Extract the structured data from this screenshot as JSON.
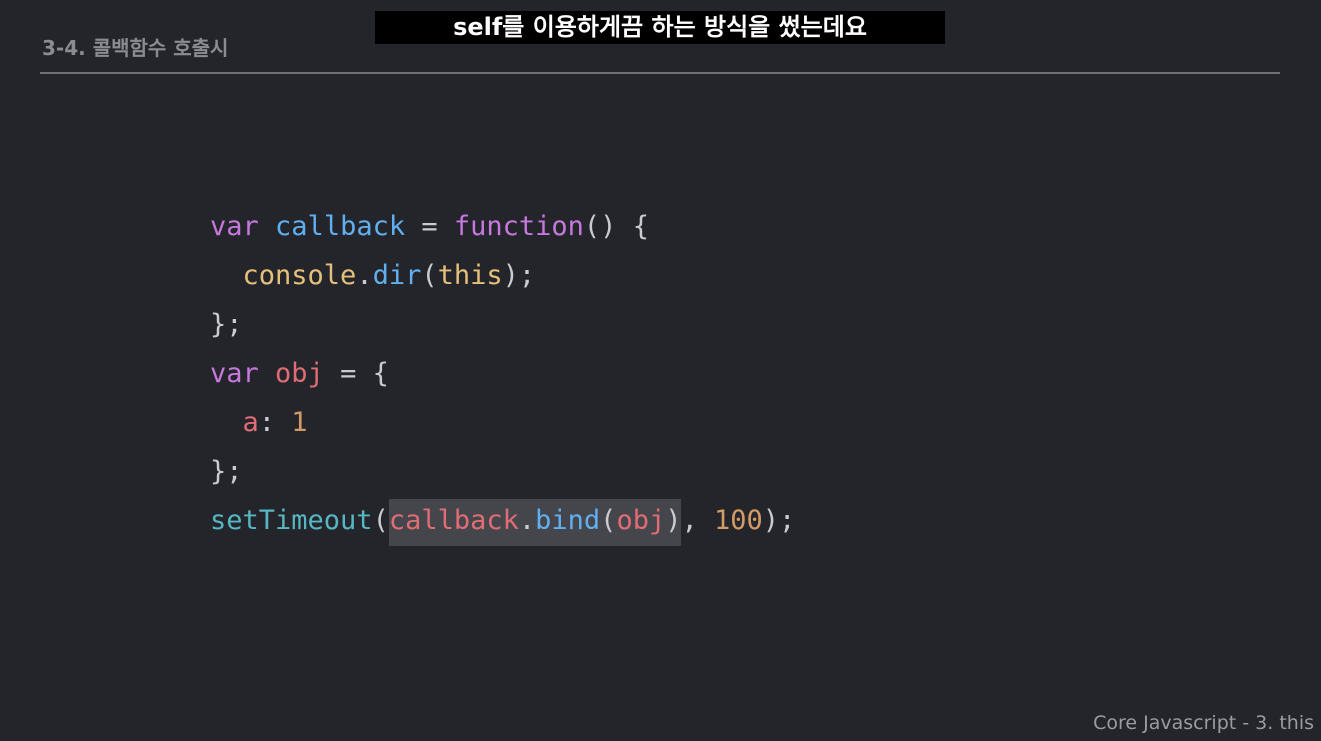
{
  "subtitle": "self를 이용하게끔 하는 방식을 썼는데요",
  "section_title": "3-4. 콜백함수 호출시",
  "footer": "Core Javascript - 3. this",
  "code": {
    "l1": {
      "kw": "var",
      "name": "callback",
      "eq": " = ",
      "fn": "function",
      "rest": "() {"
    },
    "l2": {
      "indent": "  ",
      "obj": "console",
      "dot": ".",
      "method": "dir",
      "open": "(",
      "arg": "this",
      "close": ");"
    },
    "l3": {
      "text": "};"
    },
    "l4": {
      "kw": "var",
      "name": "obj",
      "rest": " = {"
    },
    "l5": {
      "indent": "  ",
      "key": "a",
      "colon": ": ",
      "val": "1"
    },
    "l6": {
      "text": "};"
    },
    "l7": {
      "call": "setTimeout",
      "open": "(",
      "hl_obj": "callback",
      "hl_dot": ".",
      "hl_method": "bind",
      "hl_open": "(",
      "hl_arg": "obj",
      "hl_close": ")",
      "sep": ", ",
      "num": "100",
      "end": ");"
    }
  },
  "colors": {
    "background": "#23252b",
    "keyword": "#c678dd",
    "function": "#61afef",
    "object": "#e5c07b",
    "variable": "#e06c75",
    "number": "#d19a66",
    "call": "#56b6c2",
    "highlight": "#44464c"
  }
}
